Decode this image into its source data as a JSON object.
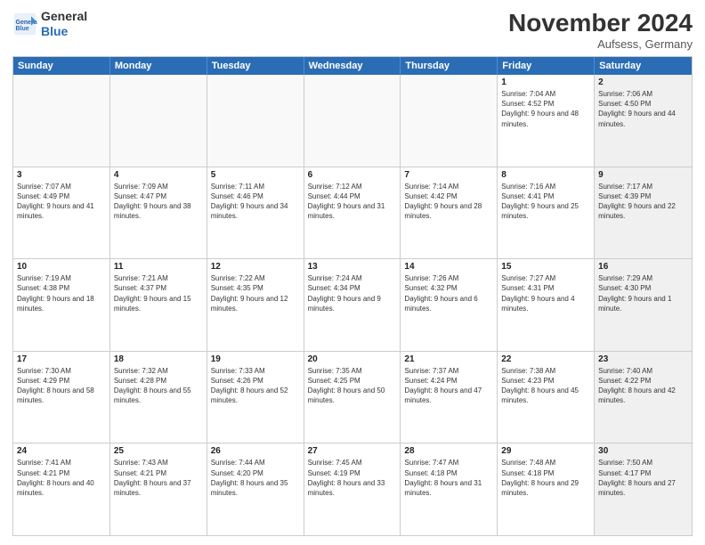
{
  "header": {
    "logo_line1": "General",
    "logo_line2": "Blue",
    "month_title": "November 2024",
    "location": "Aufsess, Germany"
  },
  "days_of_week": [
    "Sunday",
    "Monday",
    "Tuesday",
    "Wednesday",
    "Thursday",
    "Friday",
    "Saturday"
  ],
  "rows": [
    [
      {
        "day": "",
        "empty": true
      },
      {
        "day": "",
        "empty": true
      },
      {
        "day": "",
        "empty": true
      },
      {
        "day": "",
        "empty": true
      },
      {
        "day": "",
        "empty": true
      },
      {
        "day": "1",
        "sunrise": "7:04 AM",
        "sunset": "4:52 PM",
        "daylight": "9 hours and 48 minutes."
      },
      {
        "day": "2",
        "sunrise": "7:06 AM",
        "sunset": "4:50 PM",
        "daylight": "9 hours and 44 minutes."
      }
    ],
    [
      {
        "day": "3",
        "sunrise": "7:07 AM",
        "sunset": "4:49 PM",
        "daylight": "9 hours and 41 minutes."
      },
      {
        "day": "4",
        "sunrise": "7:09 AM",
        "sunset": "4:47 PM",
        "daylight": "9 hours and 38 minutes."
      },
      {
        "day": "5",
        "sunrise": "7:11 AM",
        "sunset": "4:46 PM",
        "daylight": "9 hours and 34 minutes."
      },
      {
        "day": "6",
        "sunrise": "7:12 AM",
        "sunset": "4:44 PM",
        "daylight": "9 hours and 31 minutes."
      },
      {
        "day": "7",
        "sunrise": "7:14 AM",
        "sunset": "4:42 PM",
        "daylight": "9 hours and 28 minutes."
      },
      {
        "day": "8",
        "sunrise": "7:16 AM",
        "sunset": "4:41 PM",
        "daylight": "9 hours and 25 minutes."
      },
      {
        "day": "9",
        "sunrise": "7:17 AM",
        "sunset": "4:39 PM",
        "daylight": "9 hours and 22 minutes."
      }
    ],
    [
      {
        "day": "10",
        "sunrise": "7:19 AM",
        "sunset": "4:38 PM",
        "daylight": "9 hours and 18 minutes."
      },
      {
        "day": "11",
        "sunrise": "7:21 AM",
        "sunset": "4:37 PM",
        "daylight": "9 hours and 15 minutes."
      },
      {
        "day": "12",
        "sunrise": "7:22 AM",
        "sunset": "4:35 PM",
        "daylight": "9 hours and 12 minutes."
      },
      {
        "day": "13",
        "sunrise": "7:24 AM",
        "sunset": "4:34 PM",
        "daylight": "9 hours and 9 minutes."
      },
      {
        "day": "14",
        "sunrise": "7:26 AM",
        "sunset": "4:32 PM",
        "daylight": "9 hours and 6 minutes."
      },
      {
        "day": "15",
        "sunrise": "7:27 AM",
        "sunset": "4:31 PM",
        "daylight": "9 hours and 4 minutes."
      },
      {
        "day": "16",
        "sunrise": "7:29 AM",
        "sunset": "4:30 PM",
        "daylight": "9 hours and 1 minute."
      }
    ],
    [
      {
        "day": "17",
        "sunrise": "7:30 AM",
        "sunset": "4:29 PM",
        "daylight": "8 hours and 58 minutes."
      },
      {
        "day": "18",
        "sunrise": "7:32 AM",
        "sunset": "4:28 PM",
        "daylight": "8 hours and 55 minutes."
      },
      {
        "day": "19",
        "sunrise": "7:33 AM",
        "sunset": "4:26 PM",
        "daylight": "8 hours and 52 minutes."
      },
      {
        "day": "20",
        "sunrise": "7:35 AM",
        "sunset": "4:25 PM",
        "daylight": "8 hours and 50 minutes."
      },
      {
        "day": "21",
        "sunrise": "7:37 AM",
        "sunset": "4:24 PM",
        "daylight": "8 hours and 47 minutes."
      },
      {
        "day": "22",
        "sunrise": "7:38 AM",
        "sunset": "4:23 PM",
        "daylight": "8 hours and 45 minutes."
      },
      {
        "day": "23",
        "sunrise": "7:40 AM",
        "sunset": "4:22 PM",
        "daylight": "8 hours and 42 minutes."
      }
    ],
    [
      {
        "day": "24",
        "sunrise": "7:41 AM",
        "sunset": "4:21 PM",
        "daylight": "8 hours and 40 minutes."
      },
      {
        "day": "25",
        "sunrise": "7:43 AM",
        "sunset": "4:21 PM",
        "daylight": "8 hours and 37 minutes."
      },
      {
        "day": "26",
        "sunrise": "7:44 AM",
        "sunset": "4:20 PM",
        "daylight": "8 hours and 35 minutes."
      },
      {
        "day": "27",
        "sunrise": "7:45 AM",
        "sunset": "4:19 PM",
        "daylight": "8 hours and 33 minutes."
      },
      {
        "day": "28",
        "sunrise": "7:47 AM",
        "sunset": "4:18 PM",
        "daylight": "8 hours and 31 minutes."
      },
      {
        "day": "29",
        "sunrise": "7:48 AM",
        "sunset": "4:18 PM",
        "daylight": "8 hours and 29 minutes."
      },
      {
        "day": "30",
        "sunrise": "7:50 AM",
        "sunset": "4:17 PM",
        "daylight": "8 hours and 27 minutes."
      }
    ]
  ]
}
